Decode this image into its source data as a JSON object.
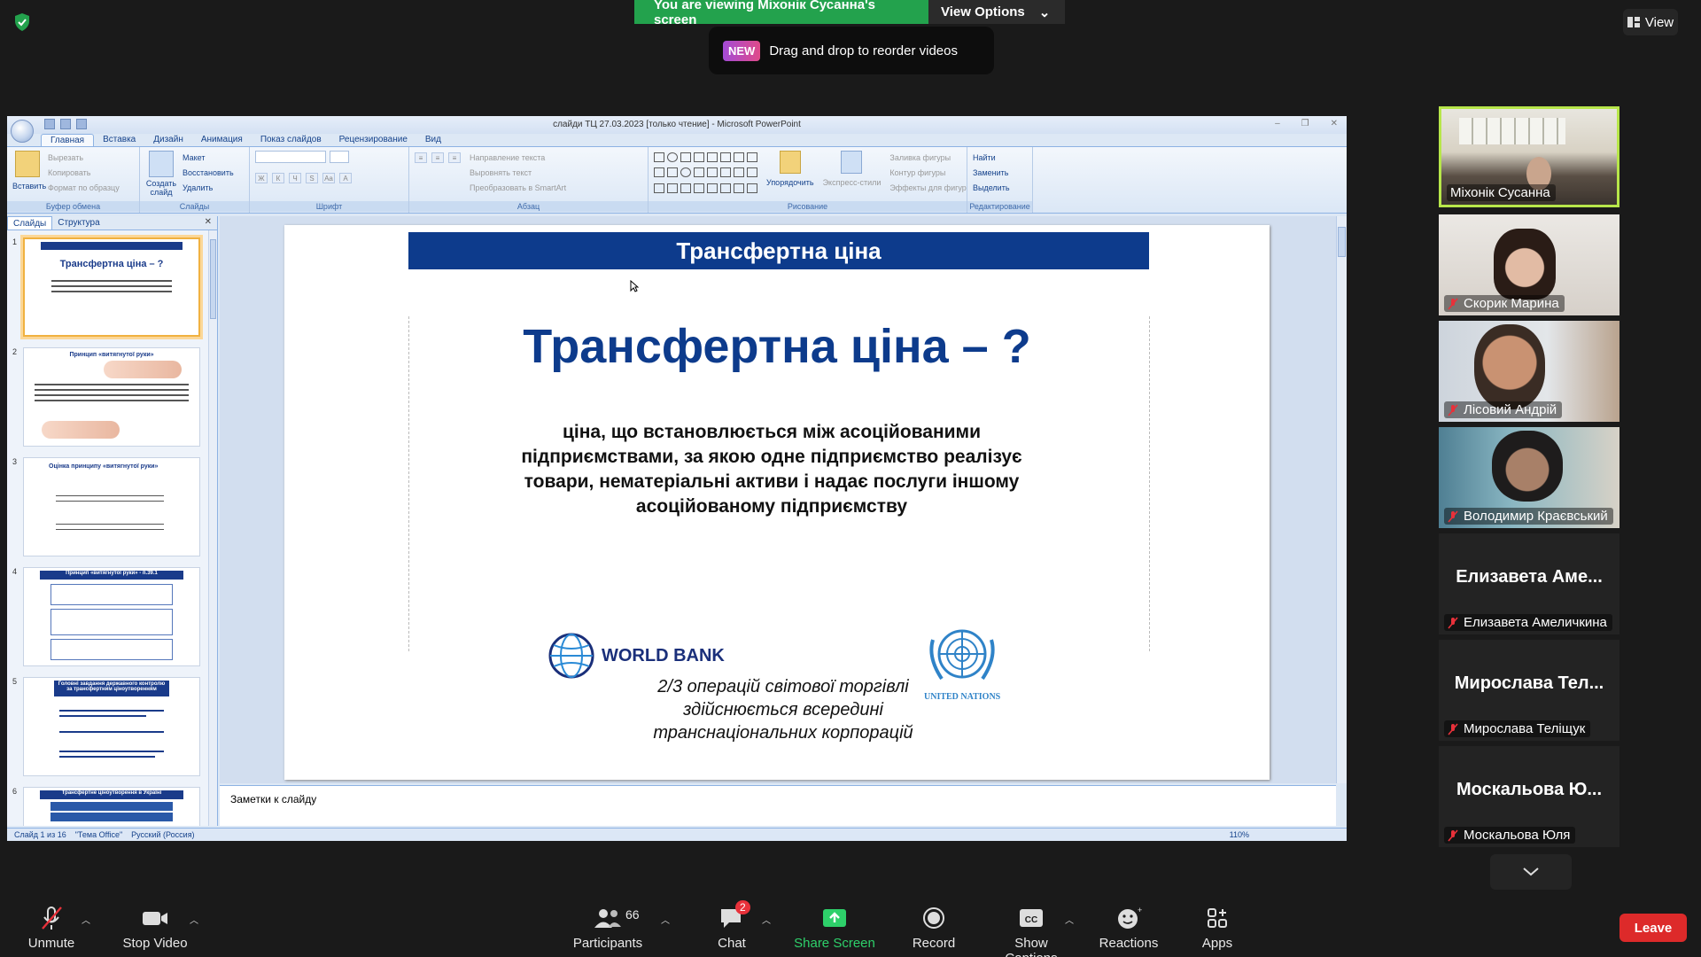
{
  "banner": {
    "viewing": "You are viewing Міхонік Сусанна's screen",
    "view_options": "View Options"
  },
  "new_pill": {
    "tag": "NEW",
    "text": "Drag and drop to reorder videos"
  },
  "view_button": "View",
  "ppt": {
    "title": "слайди ТЦ 27.03.2023 [только чтение] - Microsoft PowerPoint",
    "tabs": [
      "Главная",
      "Вставка",
      "Дизайн",
      "Анимация",
      "Показ слайдов",
      "Рецензирование",
      "Вид"
    ],
    "ribbon": {
      "clipboard": {
        "paste": "Вставить",
        "cut": "Вырезать",
        "copy": "Копировать",
        "format": "Формат по образцу",
        "label": "Буфер обмена"
      },
      "slides": {
        "create": "Создать слайд",
        "layout": "Макет",
        "restore": "Восстановить",
        "delete": "Удалить",
        "label": "Слайды"
      },
      "font": {
        "label": "Шрифт"
      },
      "paragraph": {
        "direction": "Направление текста",
        "align": "Выровнять текст",
        "smartart": "Преобразовать в SmartArt",
        "label": "Абзац"
      },
      "drawing": {
        "arrange": "Упорядочить",
        "quick_styles": "Экспресс-стили",
        "fill": "Заливка фигуры",
        "outline": "Контур фигуры",
        "effects": "Эффекты для фигур",
        "label": "Рисование"
      },
      "editing": {
        "find": "Найти",
        "replace": "Заменить",
        "select": "Выделить",
        "label": "Редактирование"
      }
    },
    "pane_tabs": {
      "slides": "Слайды",
      "outline": "Структура"
    },
    "thumbs": [
      {
        "num": "1",
        "title": "Трансфертна ціна – ?"
      },
      {
        "num": "2",
        "title": "Принцип «витягнутої руки»"
      },
      {
        "num": "3",
        "title": "Оцінка принципу «витягнутої руки»"
      },
      {
        "num": "4",
        "title": "Принцип «витягнутої руки» - п.39.1"
      },
      {
        "num": "5",
        "title": "Головні завдання державного контролю за трансфертним ціноутворенням"
      },
      {
        "num": "6",
        "title": "Трансфертне ціноутворення в Україні"
      }
    ],
    "slide": {
      "header": "Трансфертна ціна",
      "title": "Трансфертна ціна – ?",
      "body": "ціна, що встановлюється між асоційованими підприємствами, за якою одне підприємство реалізує товари, нематеріальні активи і надає послуги іншому асоційованому підприємству",
      "wb": "WORLD BANK",
      "un": "UNITED NATIONS",
      "quote": "2/3 операцій світової торгівлі здійснюється всередині транснаціональних корпорацій"
    },
    "notes": "Заметки к слайду",
    "status": {
      "slide": "Слайд 1 из 16",
      "theme": "\"Тема Office\"",
      "lang": "Русский (Россия)",
      "zoom": "110%"
    }
  },
  "participants": [
    {
      "name": "Міхонік Сусанна"
    },
    {
      "name": "Скорик Марина"
    },
    {
      "name": "Лісовий Андрій"
    },
    {
      "name": "Володимир Краєвський"
    },
    {
      "name": "Елизавета Амеличкина",
      "big": "Елизавета  Аме..."
    },
    {
      "name": "Мирослава Теліщук",
      "big": "Мирослава  Тел..."
    },
    {
      "name": "Москальова Юля",
      "big": "Москальова  Ю..."
    }
  ],
  "toolbar": {
    "unmute": "Unmute",
    "stop_video": "Stop Video",
    "participants": "Participants",
    "participants_count": "66",
    "chat": "Chat",
    "chat_badge": "2",
    "share": "Share Screen",
    "record": "Record",
    "captions": "Show Captions",
    "reactions": "Reactions",
    "apps": "Apps",
    "leave": "Leave"
  },
  "colors": {
    "share_green": "#23a24d",
    "leave_red": "#dd2a2a",
    "slide_blue": "#0d3b8c"
  }
}
